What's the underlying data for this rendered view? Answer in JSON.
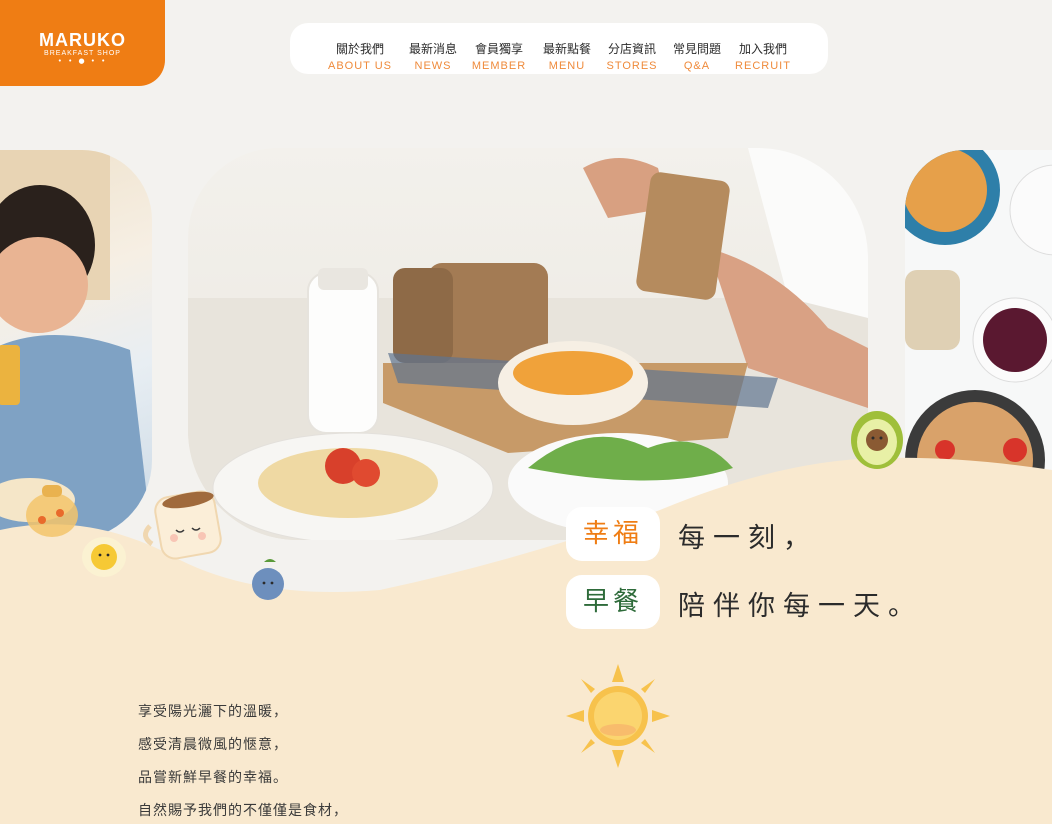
{
  "logo": {
    "name": "MARUKO",
    "subtitle": "BREAKFAST SHOP",
    "dots": "• • ● • •"
  },
  "nav": [
    {
      "zh": "關於我們",
      "en": "ABOUT US"
    },
    {
      "zh": "最新消息",
      "en": "NEWS"
    },
    {
      "zh": "會員獨享",
      "en": "MEMBER"
    },
    {
      "zh": "最新點餐",
      "en": "MENU"
    },
    {
      "zh": "分店資訊",
      "en": "STORES"
    },
    {
      "zh": "常見問題",
      "en": "Q&A"
    },
    {
      "zh": "加入我們",
      "en": "RECRUIT"
    }
  ],
  "headline": {
    "chip1": "幸福",
    "line1": "每一刻，",
    "chip2": "早餐",
    "line2": "陪伴你每一天。"
  },
  "intro": [
    "享受陽光灑下的溫暖，",
    "感受清晨微風的愜意，",
    "品嘗新鮮早餐的幸福。",
    "自然賜予我們的不僅僅是食材，"
  ],
  "colors": {
    "brand_orange": "#ef7d14",
    "cream": "#f9e9cf",
    "green": "#2e6b3a"
  }
}
